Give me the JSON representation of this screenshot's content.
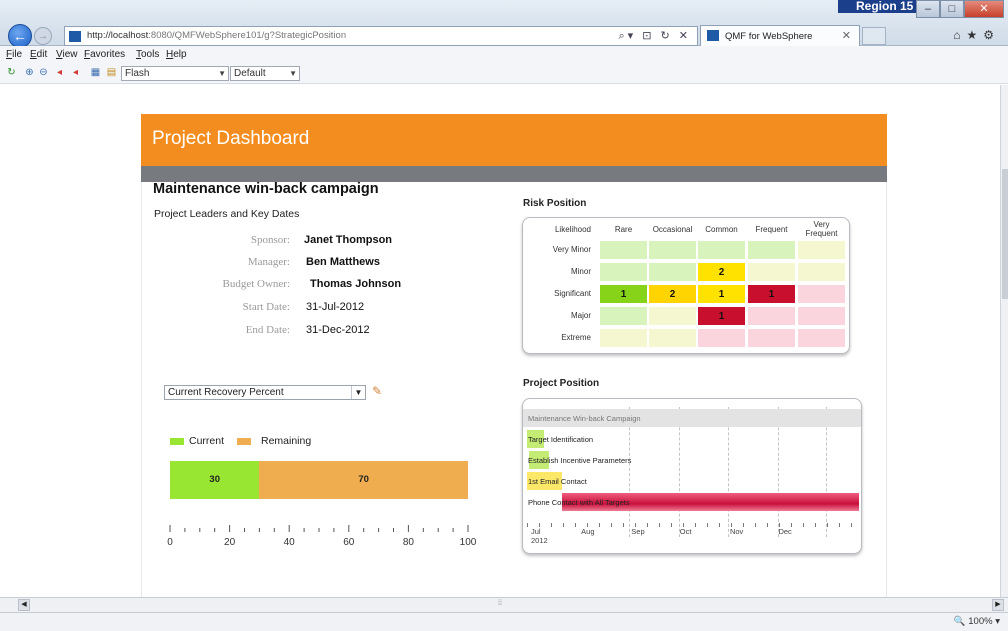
{
  "browser": {
    "region_tag": "Region 15",
    "url_host": "http://localhost",
    "url_rest": ":8080/QMFWebSphere101/g?StrategicPosition",
    "tab_title": "QMF for WebSphere",
    "menu": [
      "File",
      "Edit",
      "View",
      "Favorites",
      "Tools",
      "Help"
    ],
    "toolbar_select_1": "Flash",
    "toolbar_select_2": "Default",
    "zoom": "100%"
  },
  "dashboard": {
    "header_title": "Project Dashboard",
    "project_title": "Maintenance win-back campaign",
    "leaders_heading": "Project Leaders and Key Dates",
    "key_dates": [
      {
        "label": "Sponsor:",
        "value": "Janet Thompson"
      },
      {
        "label": "Manager:",
        "value": "Ben Matthews"
      },
      {
        "label": "Budget Owner:",
        "value": "Thomas Johnson"
      },
      {
        "label": "Start Date:",
        "value": "31-Jul-2012"
      },
      {
        "label": "End Date:",
        "value": "31-Dec-2012"
      }
    ],
    "measure_select": "Current Recovery Percent"
  },
  "chart_data": [
    {
      "type": "bar",
      "orientation": "horizontal-stacked",
      "series": [
        {
          "name": "Current",
          "value": 30,
          "color": "#99e632"
        },
        {
          "name": "Remaining",
          "value": 70,
          "color": "#efad50"
        }
      ],
      "xlim": [
        0,
        100
      ],
      "ticks": [
        0,
        20,
        40,
        60,
        80,
        100
      ]
    },
    {
      "type": "heatmap",
      "title": "Risk Position",
      "corner_label": "Likelihood",
      "columns": [
        "Rare",
        "Occasional",
        "Common",
        "Frequent",
        "Very Frequent"
      ],
      "rows": [
        "Very Minor",
        "Minor",
        "Significant",
        "Major",
        "Extreme"
      ],
      "cells": [
        [
          null,
          null,
          null,
          null,
          null
        ],
        [
          null,
          null,
          2,
          null,
          null
        ],
        [
          1,
          2,
          1,
          1,
          null
        ],
        [
          null,
          null,
          1,
          null,
          null
        ],
        [
          null,
          null,
          null,
          null,
          null
        ]
      ],
      "colors": [
        [
          "#d8f3bb",
          "#d8f3bb",
          "#d8f3bb",
          "#d8f3bb",
          "#f4f7cf"
        ],
        [
          "#d8f3bb",
          "#d8f3bb",
          "#ffe200",
          "#f4f7cf",
          "#f4f7cf"
        ],
        [
          "#86d319",
          "#ffd400",
          "#ffe200",
          "#c8102e",
          "#fbd5dd"
        ],
        [
          "#d8f3bb",
          "#f4f7cf",
          "#c8102e",
          "#fbd5dd",
          "#fbd5dd"
        ],
        [
          "#f4f7cf",
          "#f4f7cf",
          "#fbd5dd",
          "#fbd5dd",
          "#fbd5dd"
        ]
      ]
    },
    {
      "type": "gantt",
      "title": "Project Position",
      "months": [
        "Jul 2012",
        "Aug",
        "Sep",
        "Oct",
        "Nov",
        "Dec"
      ],
      "tasks": [
        {
          "name": "Maintenance Win-back Campaign",
          "start": "2012-07-31",
          "end": "2012-12-31",
          "color": "#e3e3e3"
        },
        {
          "name": "Target Identification",
          "start": "2012-07-31",
          "end": "2012-08-08",
          "color": "#c4ec74"
        },
        {
          "name": "Establish Incentive Parameters",
          "start": "2012-08-01",
          "end": "2012-08-10",
          "color": "#c4ec74"
        },
        {
          "name": "1st Email Contact",
          "start": "2012-07-31",
          "end": "2012-08-16",
          "color": "#fbe869"
        },
        {
          "name": "Phone Contact with All Targets",
          "start": "2012-08-16",
          "end": "2012-12-31",
          "color": "#d5204b"
        }
      ]
    }
  ]
}
